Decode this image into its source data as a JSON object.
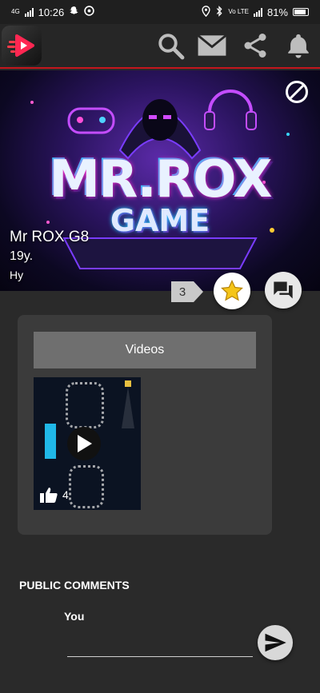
{
  "status": {
    "network": "4G",
    "time": "10:26",
    "lte": "Vo LTE",
    "battery": "81%"
  },
  "header": {
    "icons": [
      "app-logo-icon",
      "search-icon",
      "mail-icon",
      "share-icon",
      "bell-icon"
    ],
    "accent": "#c4161c"
  },
  "profile": {
    "banner_title": "MR.ROX",
    "banner_subtitle": "GAME",
    "name": "Mr ROX G8",
    "age": "19y.",
    "bio": "Hy",
    "favorites_count": "3"
  },
  "videos": {
    "tab_label": "Videos",
    "items": [
      {
        "likes": "4"
      }
    ]
  },
  "comments": {
    "title": "PUBLIC COMMENTS",
    "author_label": "You",
    "input_value": ""
  },
  "colors": {
    "background": "#2a2a2a",
    "card": "#3b3b3b",
    "tab": "#6f6f6f",
    "star": "#f5c518"
  }
}
